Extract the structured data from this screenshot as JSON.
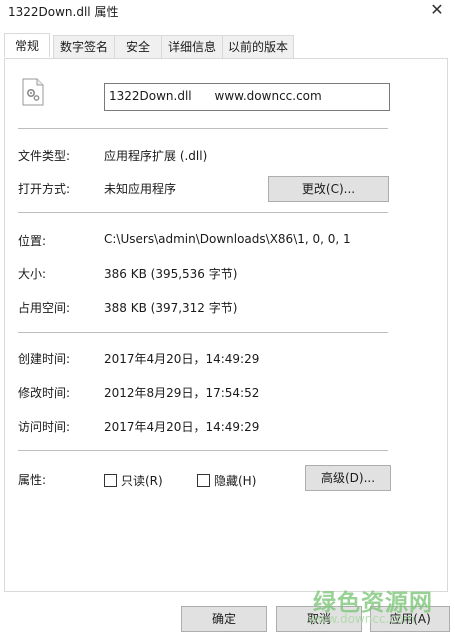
{
  "window": {
    "title": "1322Down.dll 属性",
    "close_glyph": "✕"
  },
  "tabs": [
    {
      "label": "常规",
      "active": true
    },
    {
      "label": "数字签名"
    },
    {
      "label": "安全"
    },
    {
      "label": "详细信息"
    },
    {
      "label": "以前的版本"
    }
  ],
  "general": {
    "file_name": "1322Down.dll      www.downcc.com",
    "file_type_label": "文件类型:",
    "file_type_value": "应用程序扩展 (.dll)",
    "opens_with_label": "打开方式:",
    "opens_with_value": "未知应用程序",
    "change_button": "更改(C)...",
    "location_label": "位置:",
    "location_value": "C:\\Users\\admin\\Downloads\\X86\\1, 0, 0, 1",
    "size_label": "大小:",
    "size_value": "386 KB (395,536 字节)",
    "disk_size_label": "占用空间:",
    "disk_size_value": "388 KB (397,312 字节)",
    "created_label": "创建时间:",
    "created_value": "2017年4月20日，14:49:29",
    "modified_label": "修改时间:",
    "modified_value": "2012年8月29日，17:54:52",
    "accessed_label": "访问时间:",
    "accessed_value": "2017年4月20日，14:49:29",
    "attributes_label": "属性:",
    "readonly_label": "只读(R)",
    "hidden_label": "隐藏(H)",
    "advanced_button": "高级(D)..."
  },
  "footer": {
    "ok_button": "确定",
    "cancel_button": "取消",
    "apply_button": "应用(A)"
  },
  "watermark": {
    "text": "绿色资源网",
    "sub": "www.downcc.com"
  }
}
